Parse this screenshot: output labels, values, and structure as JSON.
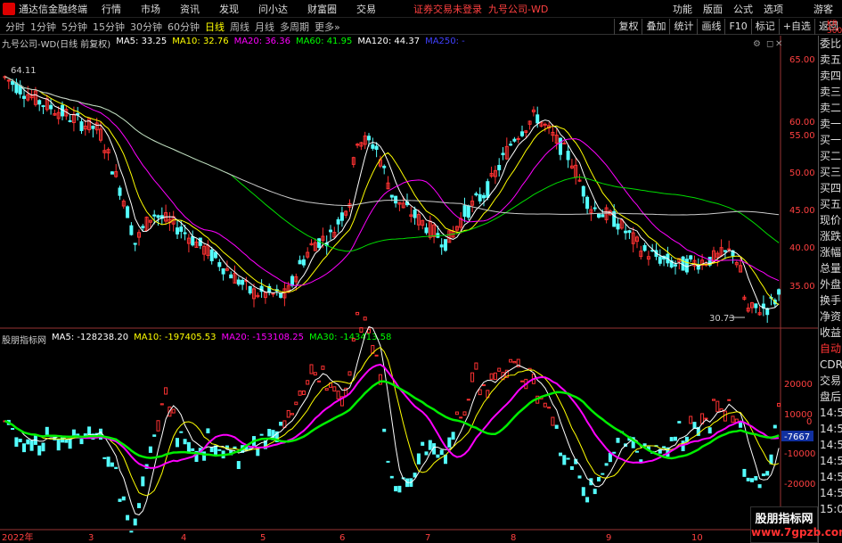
{
  "app": {
    "name": "通达信金融终端",
    "warning": "证券交易未登录",
    "stock_title": "九号公司-WD"
  },
  "menu": [
    "行情",
    "市场",
    "资讯",
    "发现",
    "问小达",
    "财富圈",
    "交易"
  ],
  "right_menu": [
    "功能",
    "版面",
    "公式",
    "选项"
  ],
  "guest": "游客",
  "timeframes": [
    "分时",
    "1分钟",
    "5分钟",
    "15分钟",
    "30分钟",
    "60分钟",
    "日线",
    "周线",
    "月线",
    "多周期",
    "更多"
  ],
  "active_timeframe": "日线",
  "toolbar_right": [
    "复权",
    "叠加",
    "统计",
    "画线",
    "F10",
    "标记",
    "+自选",
    "返回"
  ],
  "kr_badge": {
    "line1": "KR",
    "line2": "500"
  },
  "main_legend": {
    "name": "九号公司-WD(日线 前复权)",
    "items": [
      {
        "label": "MA5: 33.25",
        "color": "#ffffff"
      },
      {
        "label": "MA10: 32.76",
        "color": "#ffff00"
      },
      {
        "label": "MA20: 36.36",
        "color": "#ff00ff"
      },
      {
        "label": "MA60: 41.95",
        "color": "#00ff00"
      },
      {
        "label": "MA120: 44.37",
        "color": "#ffffff"
      },
      {
        "label": "MA250: -",
        "color": "#4040ff"
      }
    ]
  },
  "sub_legend": {
    "name": "股朋指标网",
    "items": [
      {
        "label": "MA5: -128238.20",
        "color": "#ffffff"
      },
      {
        "label": "MA10: -197405.53",
        "color": "#ffff00"
      },
      {
        "label": "MA20: -153108.25",
        "color": "#ff00ff"
      },
      {
        "label": "MA30: -143413.58",
        "color": "#00ff00"
      }
    ]
  },
  "price_axis": [
    "65.00",
    "60.00",
    "55.00",
    "50.00",
    "45.00",
    "40.00",
    "35.00"
  ],
  "sub_axis": [
    "20000",
    "10000",
    "0",
    "-10000",
    "-20000"
  ],
  "sub_axis_badge": "-7667",
  "annotations": {
    "high": "64.11",
    "low": "30.73"
  },
  "date_axis": [
    "2022年",
    "3",
    "4",
    "5",
    "6",
    "7",
    "8",
    "9",
    "10"
  ],
  "side_panel": [
    "委比",
    "卖五",
    "卖四",
    "卖三",
    "卖二",
    "卖一",
    "买一",
    "买二",
    "买三",
    "买四",
    "买五",
    "现价",
    "涨跌",
    "涨幅",
    "总量",
    "外盘",
    "换手",
    "净资",
    "收益",
    "自动",
    "CDR",
    "交易",
    "盘后",
    "14:56",
    "14:56",
    "14:56",
    "14:56",
    "14:56",
    "14:56",
    "15:00"
  ],
  "watermark": {
    "line1": "股朋指标网",
    "line2": "www.7gpzb.com"
  }
}
